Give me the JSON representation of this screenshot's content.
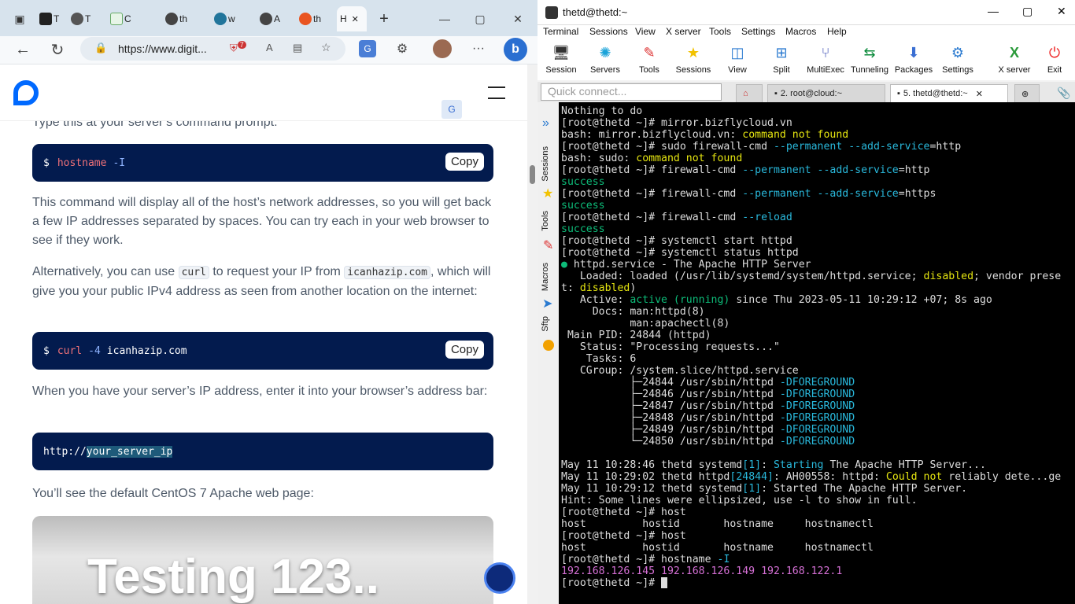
{
  "browser": {
    "tabs": [
      {
        "label": "T"
      },
      {
        "label": "T"
      },
      {
        "label": "C"
      },
      {
        "label": "th"
      },
      {
        "label": "w"
      },
      {
        "label": "A"
      },
      {
        "label": "th"
      },
      {
        "label": "H"
      }
    ],
    "url": "https://www.digit...",
    "shield_badge": "7",
    "article": {
      "p0": "Type this at your server’s command prompt:",
      "code1_prompt": "$",
      "code1_cmd": "hostname",
      "code1_arg": "-I",
      "copy_label": "Copy",
      "p1": "This command will display all of the host’s network addresses, so you will get back a few IP addresses separated by spaces. You can try each in your web browser to see if they work.",
      "p2a": "Alternatively, you can use",
      "p2_code1": "curl",
      "p2b": "to request your IP from",
      "p2_code2": "icanhazip.com",
      "p2c": ", which will give you your public IPv4 address as seen from another location on the internet:",
      "code2_prompt": "$",
      "code2_cmd": "curl",
      "code2_flag": "-4",
      "code2_arg": "icanhazip.com",
      "p3": "When you have your server’s IP address, enter it into your browser’s address bar:",
      "code3_a": "http://",
      "code3_b": "your_server_ip",
      "p4": "You’ll see the default CentOS 7 Apache web page:",
      "image_text": "Testing 123.."
    }
  },
  "mobaxterm": {
    "title": "thetd@thetd:~",
    "menu": [
      "Terminal",
      "Sessions",
      "View",
      "X server",
      "Tools",
      "Settings",
      "Macros",
      "Help"
    ],
    "toolbar": [
      "Session",
      "Servers",
      "Tools",
      "Sessions",
      "View",
      "Split",
      "MultiExec",
      "Tunneling",
      "Packages",
      "Settings",
      "X server",
      "Exit"
    ],
    "quick_connect": "Quick connect...",
    "tabs": [
      "2. root@cloud:~",
      "5. thetd@thetd:~"
    ],
    "side_tabs": [
      "Sessions",
      "Tools",
      "Macros",
      "Sftp"
    ]
  },
  "terminal": {
    "l01": "Nothing to do",
    "l02": "[root@thetd ~]# mirror.bizflycloud.vn",
    "l03a": "bash: mirror.bizflycloud.vn: ",
    "l03b": "command not found",
    "l04a": "[root@thetd ~]# sudo firewall-cmd ",
    "l04b": "--permanent --add-service",
    "l04c": "=http",
    "l05a": "bash: sudo: ",
    "l05b": "command not found",
    "l06a": "[root@thetd ~]# firewall-cmd ",
    "l06b": "--permanent --add-service",
    "l06c": "=http",
    "l07": "success",
    "l08a": "[root@thetd ~]# firewall-cmd ",
    "l08b": "--permanent --add-service",
    "l08c": "=https",
    "l09": "success",
    "l10a": "[root@thetd ~]# firewall-cmd ",
    "l10b": "--reload",
    "l11": "success",
    "l12": "[root@thetd ~]# systemctl start httpd",
    "l13": "[root@thetd ~]# systemctl status httpd",
    "l14a": "●",
    "l14b": " httpd.service - The Apache HTTP Server",
    "l15a": "   Loaded: loaded (/usr/lib/systemd/system/httpd.service; ",
    "l15b": "disabled",
    "l15c": "; vendor prese",
    "l16a": "t: ",
    "l16b": "disabled",
    "l16c": ")",
    "l17a": "   Active: ",
    "l17b": "active (running)",
    "l17c": " since Thu 2023-05-11 10:29:12 +07; 8s ago",
    "l18": "     Docs: man:httpd(8)",
    "l19": "           man:apachectl(8)",
    "l20": " Main PID: 24844 (httpd)",
    "l21": "   Status: \"Processing requests...\"",
    "l22": "    Tasks: 6",
    "l23": "   CGroup: /system.slice/httpd.service",
    "cg": [
      {
        "pid": "           ├─24844 /usr/sbin/httpd ",
        "flag": "-DFOREGROUND"
      },
      {
        "pid": "           ├─24846 /usr/sbin/httpd ",
        "flag": "-DFOREGROUND"
      },
      {
        "pid": "           ├─24847 /usr/sbin/httpd ",
        "flag": "-DFOREGROUND"
      },
      {
        "pid": "           ├─24848 /usr/sbin/httpd ",
        "flag": "-DFOREGROUND"
      },
      {
        "pid": "           ├─24849 /usr/sbin/httpd ",
        "flag": "-DFOREGROUND"
      },
      {
        "pid": "           └─24850 /usr/sbin/httpd ",
        "flag": "-DFOREGROUND"
      }
    ],
    "l30a": "May 11 10:28:46 thetd systemd",
    "l30b": "[1]",
    "l30c": ": ",
    "l30d": "Starting",
    "l30e": " The Apache HTTP Server...",
    "l31a": "May 11 10:29:02 thetd httpd",
    "l31b": "[24844]",
    "l31c": ": AH00558: httpd: ",
    "l31d": "Could not",
    "l31e": " reliably dete...ge",
    "l32a": "May 11 10:29:12 thetd systemd",
    "l32b": "[1]",
    "l32c": ": Started The Apache HTTP Server.",
    "l33": "Hint: Some lines were ellipsized, use -l to show in full.",
    "l34": "[root@thetd ~]# host",
    "l35": "host         hostid       hostname     hostnamectl",
    "l36": "[root@thetd ~]# host",
    "l37": "host         hostid       hostname     hostnamectl",
    "l38a": "[root@thetd ~]# hostname ",
    "l38b": "-I",
    "l39": "192.168.126.145 192.168.126.149 192.168.122.1",
    "l40": "[root@thetd ~]# "
  },
  "colors": {
    "code_bg": "#031b4e",
    "do_blue": "#0069ff",
    "term_yellow": "#e5e510",
    "term_green": "#0dbc79",
    "term_cyan": "#29b8db",
    "term_magenta": "#d670d6"
  }
}
